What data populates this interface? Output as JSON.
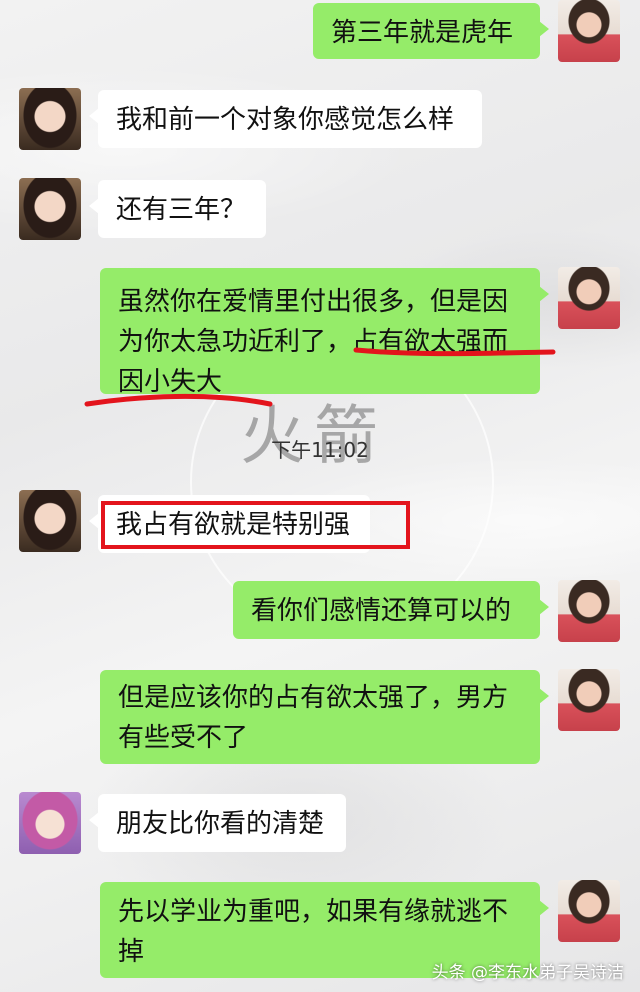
{
  "messages": [
    {
      "side": "right",
      "text": "第三年就是虎年"
    },
    {
      "side": "left",
      "text": "我和前一个对象你感觉怎么样"
    },
    {
      "side": "left",
      "text": "还有三年？"
    },
    {
      "side": "right",
      "line1": "虽然你在爱情里付出很多，但是因",
      "line2": "为你太急功近利了，占有欲太强而",
      "line3": "因小失大"
    },
    {
      "side": "left",
      "text": "我占有欲就是特别强"
    },
    {
      "side": "right",
      "text": "看你们感情还算可以的"
    },
    {
      "side": "right",
      "line1": "但是应该你的占有欲太强了，男方",
      "line2": "有些受不了"
    },
    {
      "side": "left",
      "text": "朋友比你看的清楚"
    },
    {
      "side": "right",
      "line1": "先以学业为重吧，如果有缘就逃不",
      "line2": "掉"
    }
  ],
  "timestamp": "下午11:02",
  "watermark": "头条 @李东水弟子吴诗洁",
  "background_calligraphy": "火箭",
  "colors": {
    "sent_bubble": "#95ec69",
    "received_bubble": "#ffffff",
    "annotation": "#e3141c"
  }
}
